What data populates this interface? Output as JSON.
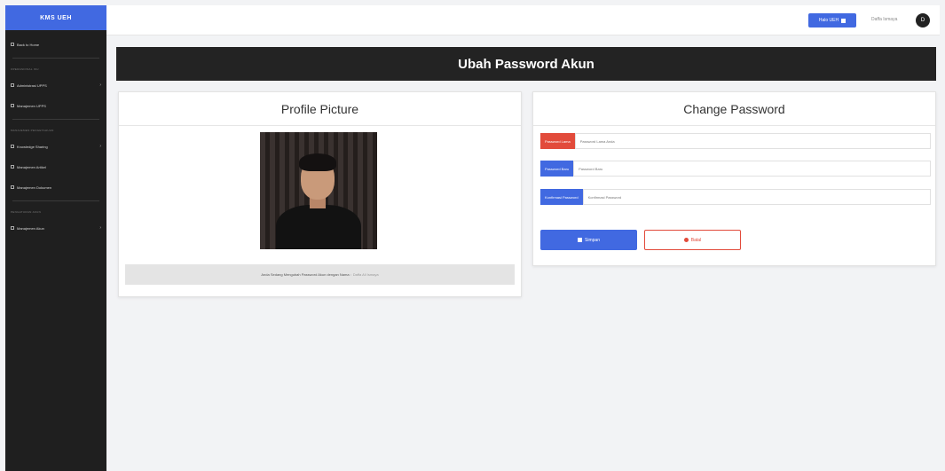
{
  "sidebar": {
    "brand": "KMS UEH",
    "items": [
      {
        "label": "Back to Home",
        "chevron": false
      },
      {
        "heading": "Operasional IKU"
      },
      {
        "label": "Administrasi UPPS",
        "chevron": true
      },
      {
        "label": "Manajemen UPPS",
        "chevron": false
      },
      {
        "heading": "Manajemen Pengetahuan"
      },
      {
        "label": "Knowledge Sharing",
        "chevron": true
      },
      {
        "label": "Manajemen Artikel",
        "chevron": false
      },
      {
        "label": "Manajemen Dokumen",
        "chevron": false
      },
      {
        "heading": "Pengaturan Akun"
      },
      {
        "label": "Manajemen Akun",
        "chevron": true
      }
    ]
  },
  "topbar": {
    "button_label": "Halo UEH",
    "user_name": "Daffa Ismaya",
    "avatar_initial": "D"
  },
  "page": {
    "title": "Ubah Password Akun"
  },
  "profile": {
    "title": "Profile Picture",
    "info_text": "Anda Sedang Mengubah Password Akun dengan Nama :",
    "info_name": "Daffa Ali Ismaya"
  },
  "change_password": {
    "title": "Change Password",
    "old_label": "Password Lama",
    "old_placeholder": "Password Lama Anda",
    "new_label": "Password Baru",
    "new_placeholder": "Password Baru",
    "confirm_label": "Konfirmasi Password",
    "confirm_placeholder": "Konfirmasi Password",
    "save_label": "Simpan",
    "reset_label": "Batal"
  },
  "colors": {
    "primary": "#4169e1",
    "danger": "#e24b3b",
    "sidebar_bg": "#1f1f1f",
    "header_bg": "#232323"
  }
}
